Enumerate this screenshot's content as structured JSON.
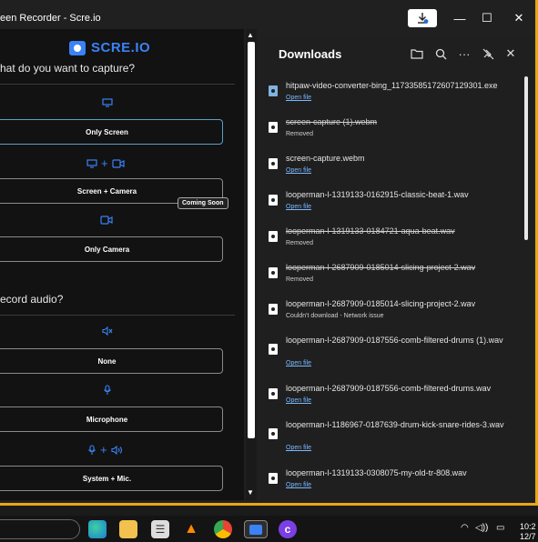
{
  "window": {
    "title": "een Recorder - Scre.io",
    "minimize_icon": "minimize-icon",
    "maximize_icon": "maximize-icon",
    "close_icon": "close-icon"
  },
  "app": {
    "brand": "SCRE.IO",
    "capture_question": "hat do you want to capture?",
    "audio_question": "ecord audio?",
    "options": [
      {
        "label": "Only Screen",
        "icon": "monitor-icon"
      },
      {
        "label": "Screen + Camera",
        "icon": "monitor-plus-camera-icon"
      },
      {
        "label": "Only Camera",
        "icon": "camera-icon"
      }
    ],
    "coming_soon": "Coming Soon",
    "audio_options": [
      {
        "label": "None",
        "icon": "speaker-muted-icon"
      },
      {
        "label": "Microphone",
        "icon": "microphone-icon"
      },
      {
        "label": "System + Mic.",
        "icon": "mic-plus-speaker-icon"
      }
    ]
  },
  "downloads": {
    "title": "Downloads",
    "items": [
      {
        "name": "hitpaw-video-converter-bing_11733585172607129301.exe",
        "status": "Open file",
        "status_type": "link",
        "struck": false,
        "icon": "exe-icon"
      },
      {
        "name": "screen-capture (1).webm",
        "status": "Removed",
        "status_type": "text",
        "struck": true,
        "icon": "file-icon"
      },
      {
        "name": "screen-capture.webm",
        "status": "Open file",
        "status_type": "link",
        "struck": false,
        "icon": "file-icon"
      },
      {
        "name": "looperman-l-1319133-0162915-classic-beat-1.wav",
        "status": "Open file",
        "status_type": "link",
        "struck": false,
        "icon": "file-icon"
      },
      {
        "name": "looperman-l-1319133-0184721-aqua-beat.wav",
        "status": "Removed",
        "status_type": "text",
        "struck": true,
        "icon": "file-icon"
      },
      {
        "name": "looperman-l-2687909-0185014-slicing-project-2.wav",
        "status": "Removed",
        "status_type": "text",
        "struck": true,
        "icon": "file-icon"
      },
      {
        "name": "looperman-l-2687909-0185014-slicing-project-2.wav",
        "status": "Couldn't download - Network issue",
        "status_type": "text",
        "struck": false,
        "icon": "file-icon"
      },
      {
        "name": "looperman-l-2687909-0187556-comb-filtered-drums (1).wav",
        "status": "Open file",
        "status_type": "link",
        "struck": false,
        "icon": "file-icon"
      },
      {
        "name": "looperman-l-2687909-0187556-comb-filtered-drums.wav",
        "status": "Open file",
        "status_type": "link",
        "struck": false,
        "icon": "file-icon"
      },
      {
        "name": "looperman-l-1186967-0187639-drum-kick-snare-rides-3.wav",
        "status": "Open file",
        "status_type": "link",
        "struck": false,
        "icon": "file-icon"
      },
      {
        "name": "looperman-l-1319133-0308075-my-old-tr-808.wav",
        "status": "Open file",
        "status_type": "link",
        "struck": false,
        "icon": "file-icon"
      }
    ]
  },
  "taskbar": {
    "clock_time": "10:2",
    "clock_date": "12/7"
  }
}
